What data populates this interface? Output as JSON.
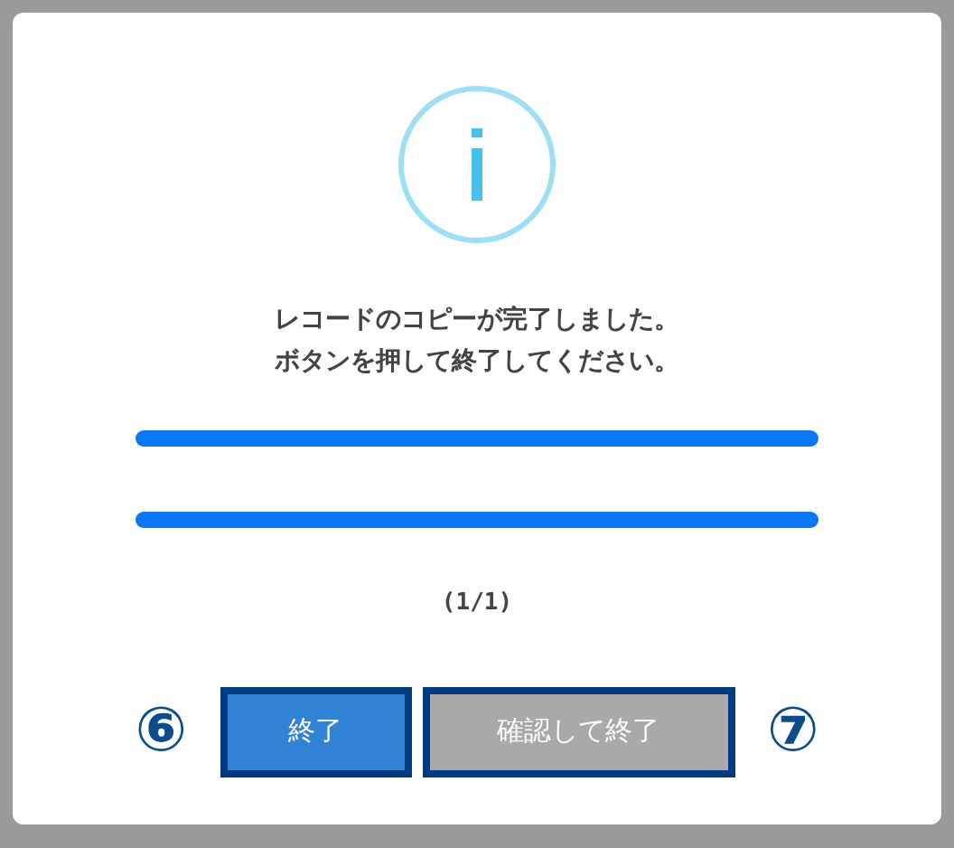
{
  "dialog": {
    "message_lines": [
      "レコードのコピーが完了しました。",
      "ボタンを押して終了してください。"
    ],
    "progress_bars": [
      {
        "level": 1
      },
      {
        "level": 1
      }
    ],
    "counter": "(1/1)",
    "callouts": [
      "⑥",
      "⑦"
    ],
    "actions": [
      {
        "label": "終了",
        "kind": "primary",
        "outlined": true
      },
      {
        "label": "確認して終了",
        "kind": "secondary",
        "outlined": true
      }
    ]
  }
}
